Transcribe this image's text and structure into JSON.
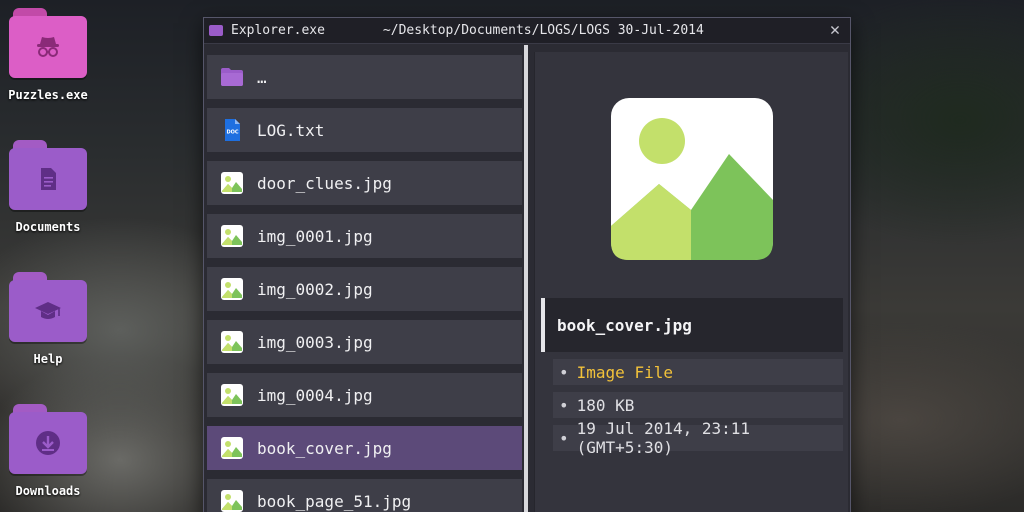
{
  "desktop": {
    "icons": [
      {
        "label": "Puzzles.exe",
        "icon": "spy-icon",
        "color": "#dc5ec6"
      },
      {
        "label": "Documents",
        "icon": "document-icon",
        "color": "#9b5cc9"
      },
      {
        "label": "Help",
        "icon": "graduation-cap-icon",
        "color": "#9b5cc9"
      },
      {
        "label": "Downloads",
        "icon": "download-icon",
        "color": "#9b5cc9"
      }
    ]
  },
  "window": {
    "title": "Explorer.exe",
    "path": "~/Desktop/Documents/LOGS/LOGS 30-Jul-2014",
    "close_label": "✕"
  },
  "files": [
    {
      "name": "…",
      "icon": "folder-icon"
    },
    {
      "name": "LOG.txt",
      "icon": "doc-icon"
    },
    {
      "name": "door_clues.jpg",
      "icon": "image-icon"
    },
    {
      "name": "img_0001.jpg",
      "icon": "image-icon"
    },
    {
      "name": "img_0002.jpg",
      "icon": "image-icon"
    },
    {
      "name": "img_0003.jpg",
      "icon": "image-icon"
    },
    {
      "name": "img_0004.jpg",
      "icon": "image-icon"
    },
    {
      "name": "book_cover.jpg",
      "icon": "image-icon",
      "selected": true
    },
    {
      "name": "book_page_51.jpg",
      "icon": "image-icon"
    }
  ],
  "preview": {
    "file_name": "book_cover.jpg",
    "type": "Image File",
    "size": "180 KB",
    "date": "19 Jul 2014, 23:11 (GMT+5:30)",
    "bullet": "•"
  },
  "colors": {
    "accent_type": "#f2c23a",
    "selected_row": "#5c4a79",
    "folder_purple": "#9b5cc9",
    "folder_pink": "#dc5ec6"
  }
}
